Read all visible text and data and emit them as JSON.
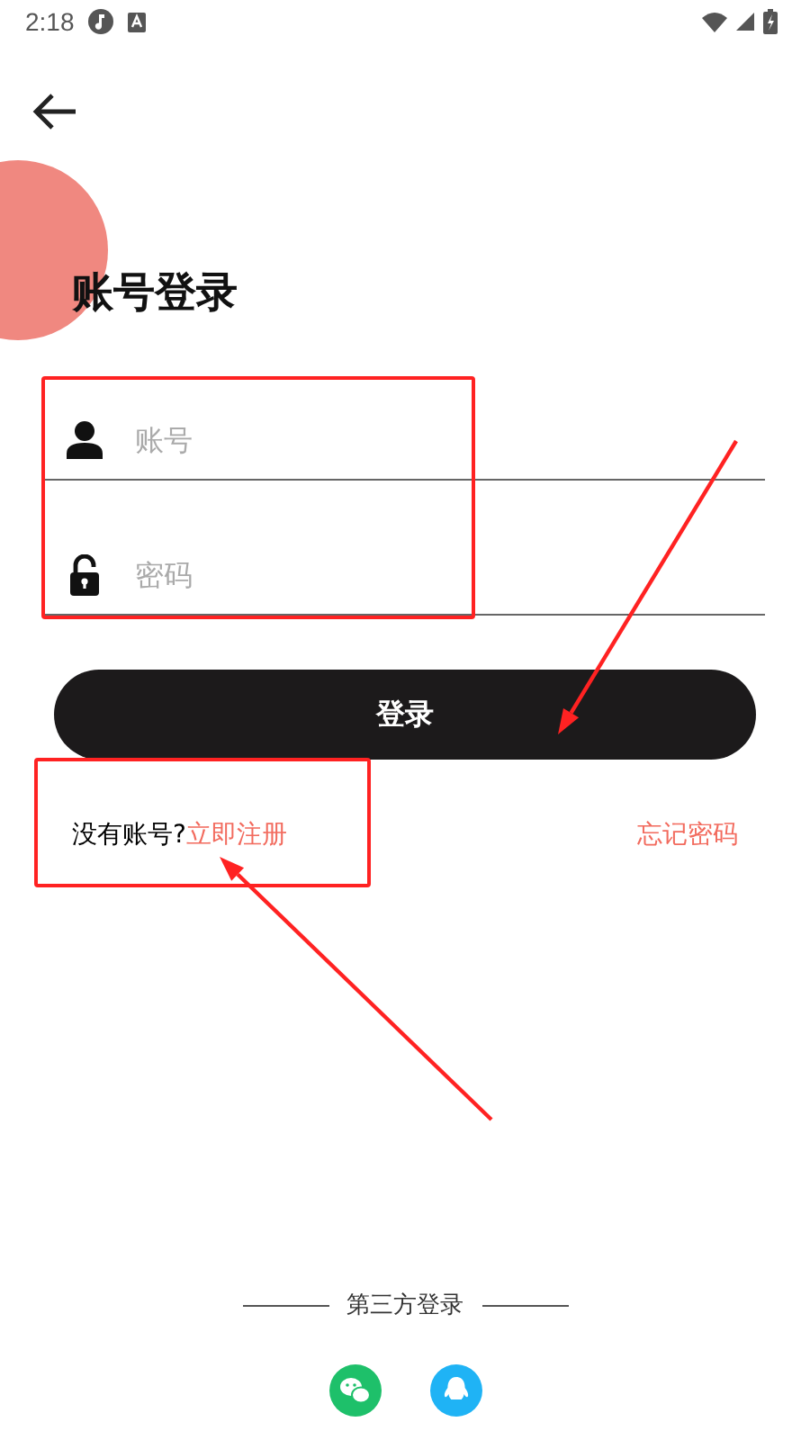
{
  "status_bar": {
    "time": "2:18"
  },
  "title": "账号登录",
  "fields": [
    {
      "kind": "account",
      "placeholder": "账号"
    },
    {
      "kind": "password",
      "placeholder": "密码"
    }
  ],
  "login_button": "登录",
  "register_prompt": {
    "text": "没有账号?",
    "link": "立即注册"
  },
  "forgot_link": "忘记密码",
  "third_party": {
    "label": "第三方登录",
    "providers": [
      {
        "kind": "wechat"
      },
      {
        "kind": "qq"
      }
    ]
  },
  "annotations": [
    {
      "kind": "frame"
    },
    {
      "kind": "frame"
    },
    {
      "kind": "arrow"
    },
    {
      "kind": "arrow"
    }
  ]
}
